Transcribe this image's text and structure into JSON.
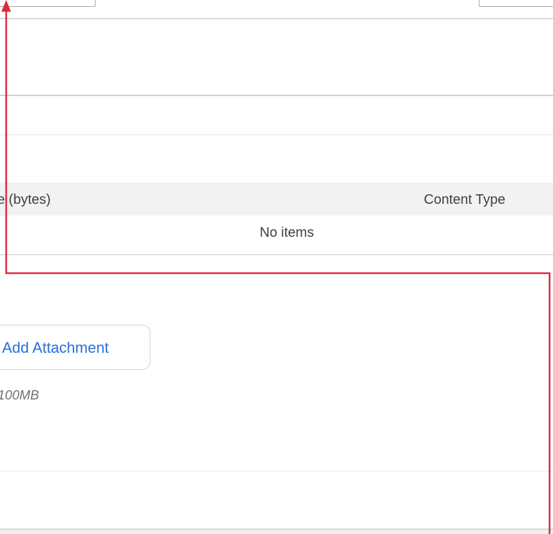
{
  "table": {
    "columns": {
      "size_partial": "e (bytes)",
      "content_type": "Content Type"
    },
    "empty_message": "No items"
  },
  "attachments": {
    "add_button_label": "Add Attachment",
    "size_limit_partial": "/ 100MB"
  },
  "annotation": {
    "arrow_color": "#e0283a"
  },
  "colors": {
    "link_blue": "#2b6fd6",
    "header_bg": "#f2f2f2"
  }
}
